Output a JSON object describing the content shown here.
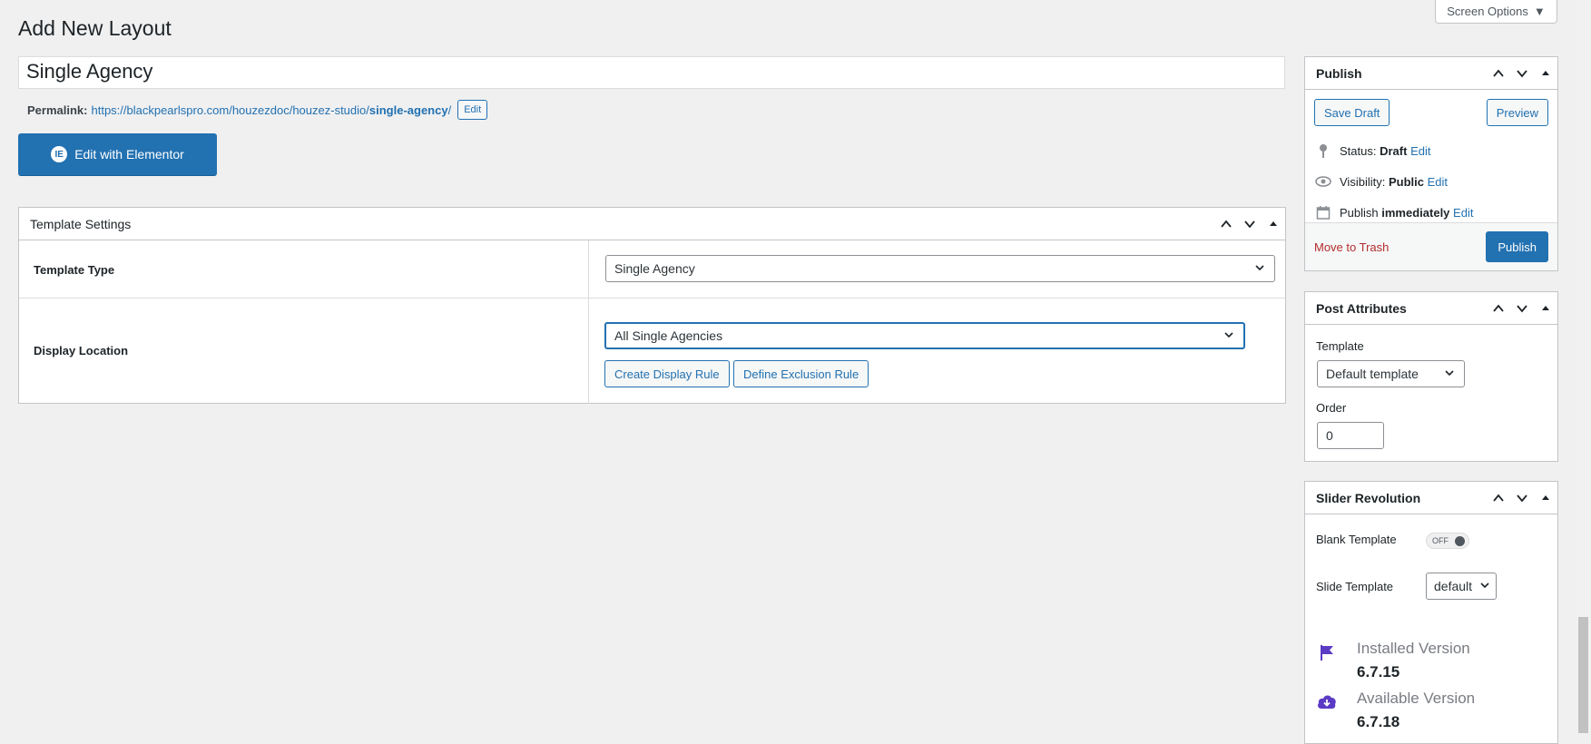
{
  "header": {
    "title": "Add New Layout",
    "screen_options": "Screen Options"
  },
  "post_title": "Single Agency",
  "permalink": {
    "label": "Permalink:",
    "url_base": "https://blackpearlspro.com/houzezdoc/houzez-studio/",
    "url_slug": "single-agency",
    "url_trailing": "/",
    "edit_label": "Edit"
  },
  "elementor": {
    "label": "Edit with Elementor",
    "icon": "elementor-icon"
  },
  "template_settings": {
    "title": "Template Settings",
    "rows": [
      {
        "label": "Template Type",
        "value": "Single Agency"
      },
      {
        "label": "Display Location",
        "value": "All Single Agencies"
      }
    ],
    "create_rule": "Create Display Rule",
    "exclusion_rule": "Define Exclusion Rule"
  },
  "publish": {
    "title": "Publish",
    "save_draft": "Save Draft",
    "preview": "Preview",
    "status_label": "Status:",
    "status_value": "Draft",
    "visibility_label": "Visibility:",
    "visibility_value": "Public",
    "publish_label": "Publish",
    "publish_value": "immediately",
    "edit": "Edit",
    "move_to_trash": "Move to Trash",
    "publish_button": "Publish"
  },
  "post_attributes": {
    "title": "Post Attributes",
    "template_label": "Template",
    "template_value": "Default template",
    "order_label": "Order",
    "order_value": "0"
  },
  "slider_revolution": {
    "title": "Slider Revolution",
    "blank_template_label": "Blank Template",
    "toggle_state": "OFF",
    "slide_template_label": "Slide Template",
    "slide_template_value": "default",
    "installed_label": "Installed Version",
    "installed_value": "6.7.15",
    "available_label": "Available Version",
    "available_value": "6.7.18"
  },
  "colors": {
    "primary": "#2271b1",
    "background": "#f0f0f1",
    "trash": "#b32d2e",
    "slider_icon": "#5b3bc4"
  }
}
